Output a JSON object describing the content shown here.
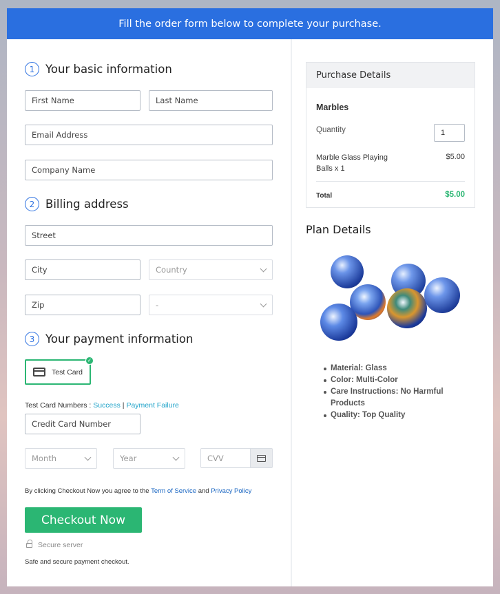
{
  "banner": {
    "text": "Fill the order form below to complete your purchase."
  },
  "basic_info": {
    "number": "1",
    "title": "Your basic information",
    "first_name_placeholder": "First Name",
    "last_name_placeholder": "Last Name",
    "email_placeholder": "Email Address",
    "company_placeholder": "Company Name"
  },
  "billing": {
    "number": "2",
    "title": "Billing address",
    "street_placeholder": "Street",
    "city_placeholder": "City",
    "country_placeholder": "Country",
    "zip_placeholder": "Zip",
    "state_placeholder": "-"
  },
  "payment": {
    "number": "3",
    "title": "Your payment information",
    "test_card_label": "Test Card",
    "test_numbers_label": "Test Card Numbers : ",
    "success_link": "Success",
    "separator": " | ",
    "failure_link": "Payment Failure",
    "card_number_placeholder": "Credit Card Number",
    "month_placeholder": "Month",
    "year_placeholder": "Year",
    "cvv_placeholder": "CVV"
  },
  "terms": {
    "prefix": "By clicking Checkout Now you agree to the ",
    "terms_link": "Term of Service",
    "and": " and ",
    "privacy_link": "Privacy Policy"
  },
  "checkout": {
    "button_label": "Checkout Now",
    "secure_label": "Secure server",
    "safe_note": "Safe and secure payment checkout."
  },
  "purchase_details": {
    "header": "Purchase Details",
    "product_title": "Marbles",
    "quantity_label": "Quantity",
    "quantity_value": "1",
    "item_name_line1": "Marble Glass Playing",
    "item_name_line2": "Balls x 1",
    "item_price": "$5.00",
    "total_label": "Total",
    "total_value": "$5.00",
    "total_color": "#2bb673"
  },
  "plan_details": {
    "title": "Plan Details",
    "features": [
      "Material: Glass",
      "Color: Multi-Color",
      "Care Instructions: No Harmful Products",
      "Quality: Top Quality"
    ]
  },
  "colors": {
    "accent": "#2a6fe0",
    "success": "#2bb673",
    "link": "#1fa3c9"
  }
}
